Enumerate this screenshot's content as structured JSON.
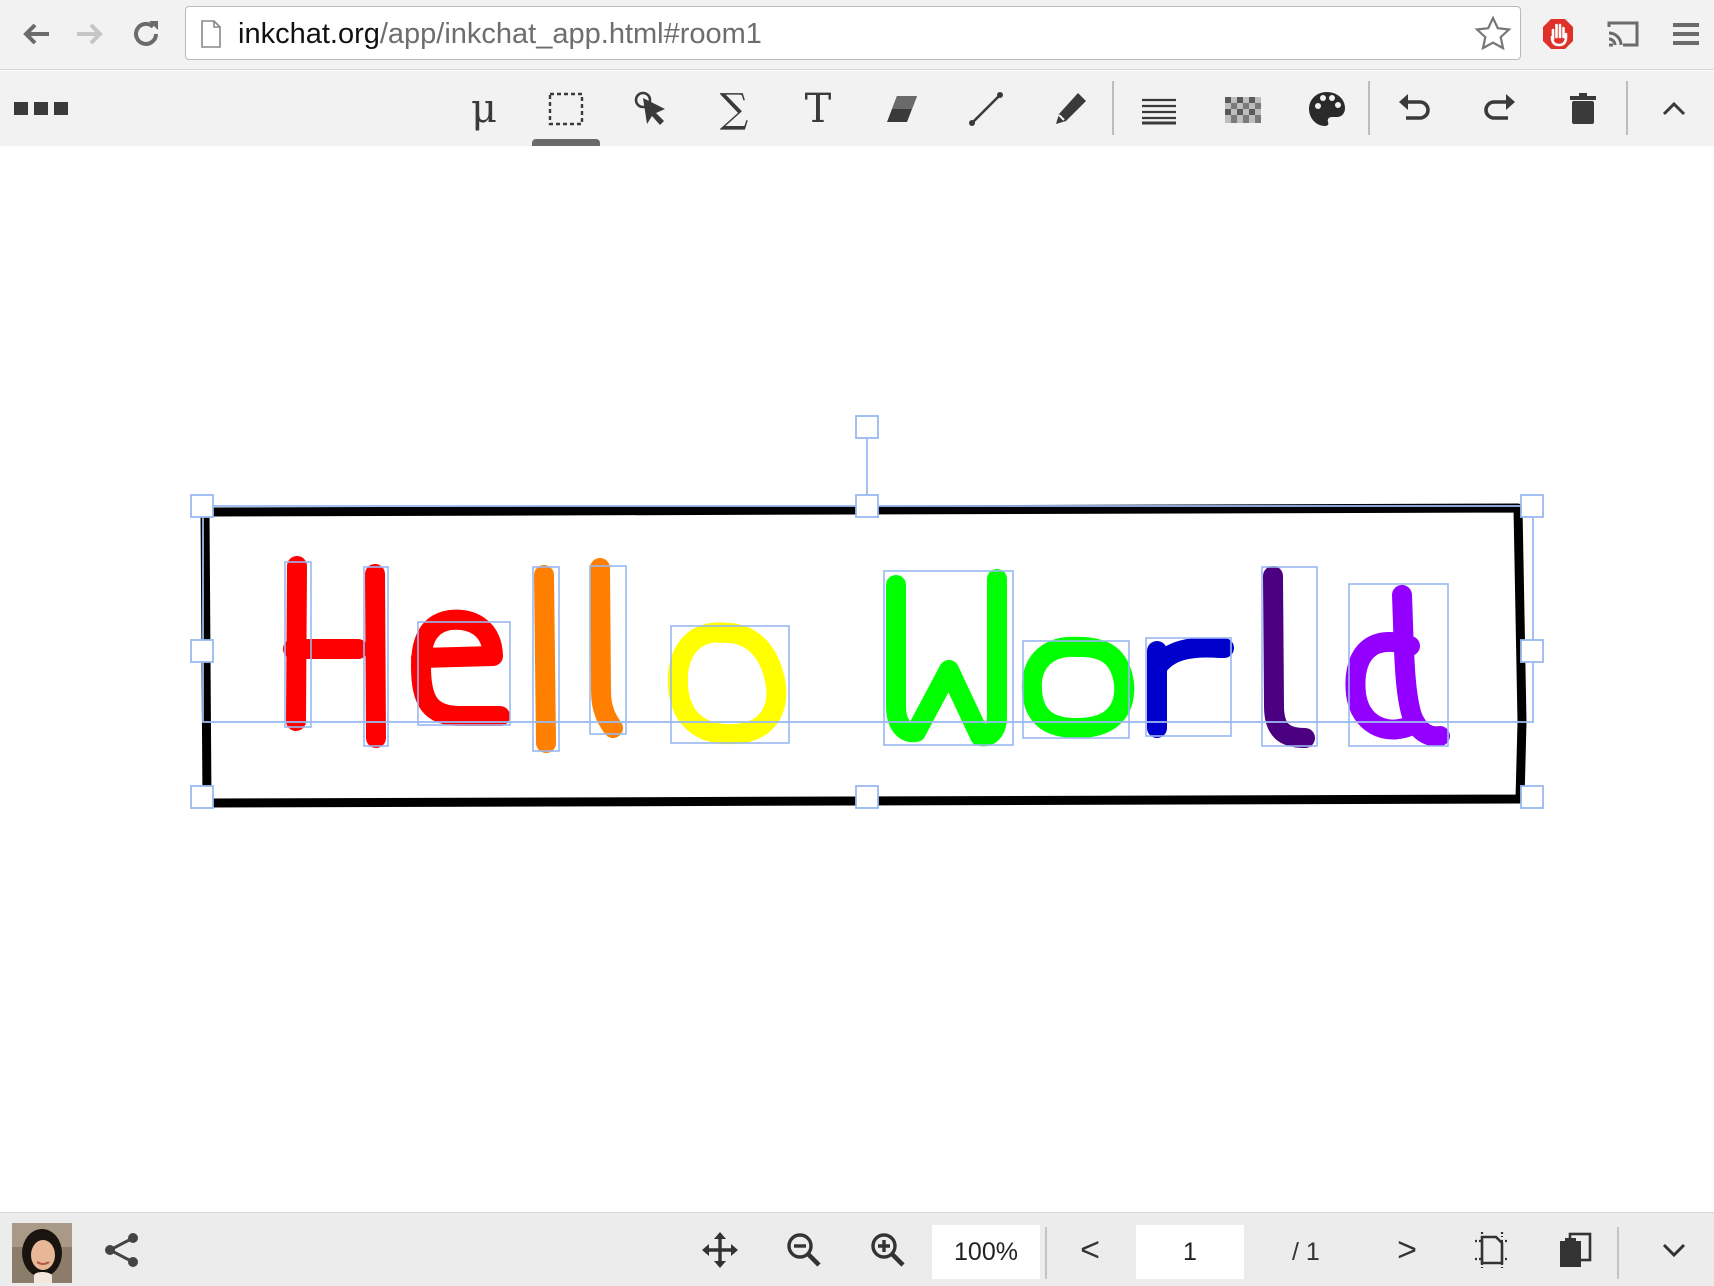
{
  "browser": {
    "url_host": "inkchat.org",
    "url_path": "/app/inkchat_app.html#room1"
  },
  "toolbar": {
    "tools": [
      {
        "id": "mu",
        "glyph": "μ"
      },
      {
        "id": "select",
        "icon": "dashed-rectangle-select-icon",
        "active": true
      },
      {
        "id": "pointer",
        "icon": "pointer-touch-icon"
      },
      {
        "id": "sigma",
        "glyph": "∑"
      },
      {
        "id": "text",
        "glyph": "T"
      },
      {
        "id": "eraser",
        "icon": "eraser-icon"
      },
      {
        "id": "line",
        "icon": "line-icon"
      },
      {
        "id": "pencil",
        "icon": "pencil-icon"
      },
      {
        "id": "stroke-width",
        "icon": "stroke-width-icon"
      },
      {
        "id": "pattern",
        "icon": "checker-pattern-icon"
      },
      {
        "id": "palette",
        "icon": "palette-icon"
      },
      {
        "id": "undo",
        "icon": "undo-icon"
      },
      {
        "id": "redo",
        "icon": "redo-icon"
      },
      {
        "id": "delete",
        "icon": "trash-icon"
      },
      {
        "id": "collapse",
        "icon": "chevron-up-icon"
      }
    ]
  },
  "canvas": {
    "text": "Hello World",
    "letter_colors": [
      "#ff0000",
      "#ff0000",
      "#ff7f00",
      "#ff7f00",
      "#ffff00",
      "#00ff00",
      "#00ff00",
      "#0000cc",
      "#4b0082",
      "#9400ff"
    ],
    "frame_color": "#000000",
    "selection_color": "#9ab8f0"
  },
  "bottombar": {
    "zoom": "100%",
    "page_current": "1",
    "page_total": "/ 1",
    "prev": "<",
    "next": ">"
  }
}
